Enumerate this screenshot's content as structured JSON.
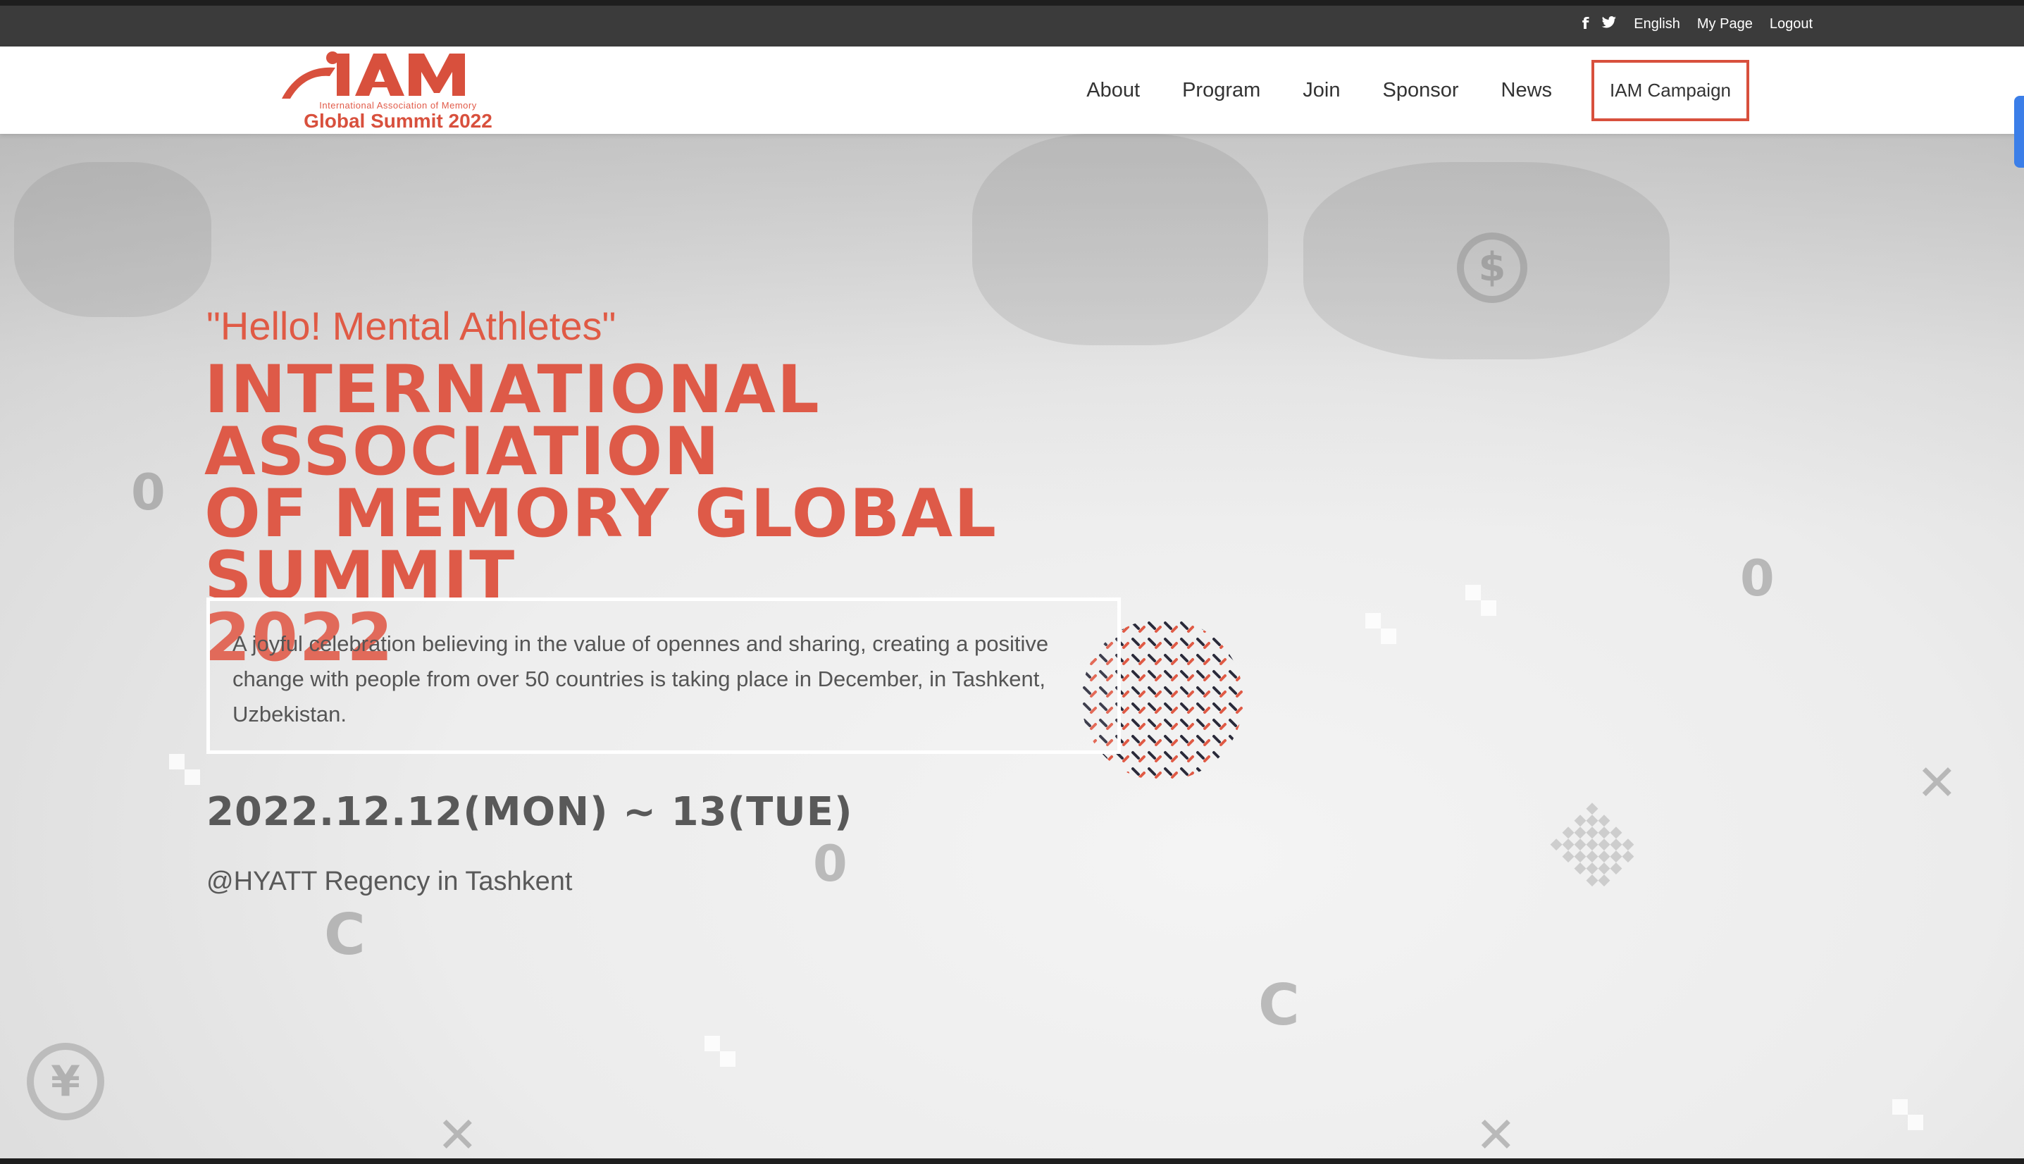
{
  "topbar": {
    "facebook_icon": "facebook-icon",
    "twitter_icon": "twitter-icon",
    "language": "English",
    "my_page": "My Page",
    "logout": "Logout"
  },
  "logo": {
    "name": "IAM",
    "subtitle": "International Association of Memory",
    "event": "Global Summit 2022"
  },
  "nav": {
    "items": [
      "About",
      "Program",
      "Join",
      "Sponsor",
      "News"
    ],
    "campaign": "IAM Campaign"
  },
  "hero": {
    "tagline": "\"Hello! Mental Athletes\"",
    "title_line1": "INTERNATIONAL ASSOCIATION",
    "title_line2": "OF MEMORY GLOBAL SUMMIT",
    "title_line3": "2022",
    "description": "A joyful celebration believing in the value of opennes and sharing, creating a positive change with people from over 50 countries is taking place in December, in Tashkent, Uzbekistan.",
    "date": "2022.12.12(MON) ~ 13(TUE)",
    "venue": "@HYATT Regency in Tashkent"
  },
  "colors": {
    "accent": "#de5a48",
    "topbar": "#3b3b3b",
    "text": "#595959"
  }
}
